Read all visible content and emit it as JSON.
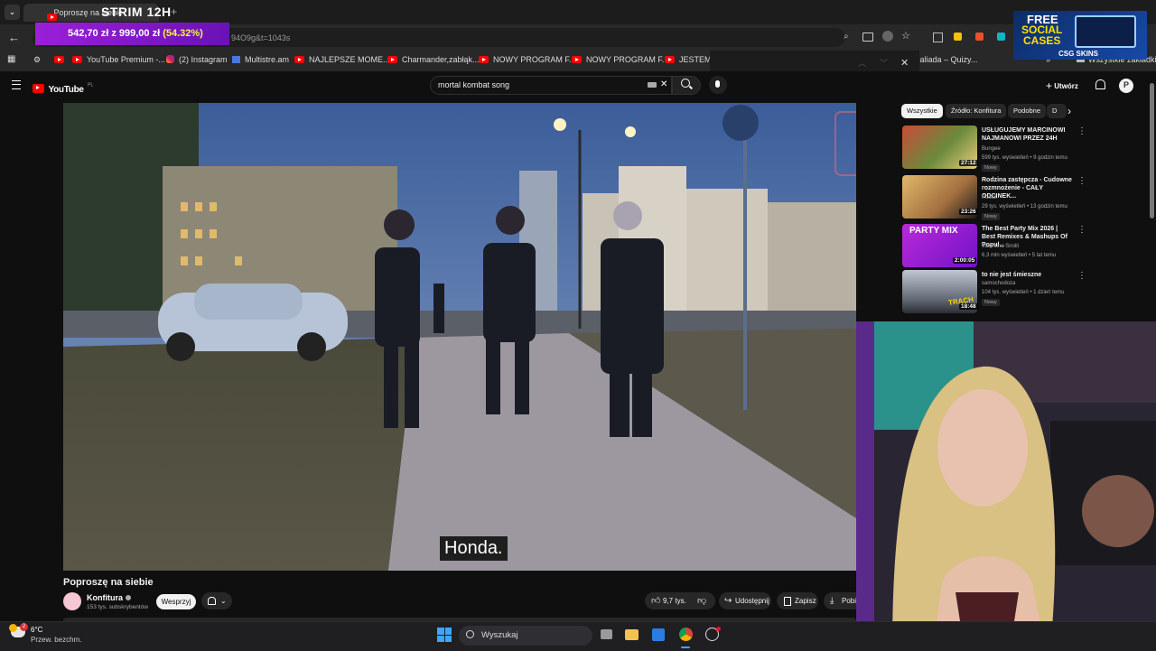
{
  "browser": {
    "tab_title": "Poproszę na siebie",
    "url_fragment": "94O9g&t=1043s",
    "bookmarks": [
      "YouTube Premium -...",
      "(2) Instagram",
      "Multistre.am",
      "NAJLEPSZE MOME...",
      "Charmander,zabłąk...",
      "NOWY PROGRAM F...",
      "NOWY PROGRAM F...",
      "JESTEM D",
      "sialiada – Quizy...",
      "Wszystkie zakładki"
    ]
  },
  "overlays": {
    "stream_label": "STRIM 12H",
    "donation_amount": "542,70 zł z 999,00 zł",
    "donation_percent": "(54.32%)",
    "ad_line1": "FREE",
    "ad_line2": "SOCIAL",
    "ad_line3": "CASES",
    "ad_brand": "CSG SKINS"
  },
  "youtube": {
    "logo": "YouTube",
    "logo_region": "PL",
    "search_query": "mortal kombat song",
    "create_label": "Utwórz",
    "subtitle": "Honda.",
    "video_title": "Poproszę na siebie",
    "channel_name": "Konfitura",
    "subscribers": "153 tys. subskrybentów",
    "support_label": "Wesprzyj",
    "likes": "9,7 tys.",
    "share_label": "Udostępnij",
    "save_label": "Zapisz",
    "download_label": "Pobi",
    "chips": [
      "Wszystkie",
      "Źródło: Konfitura",
      "Podobne",
      "D"
    ],
    "recommendations": [
      {
        "title": "USŁUGUJEMY MARCINOWI NAJMANOWI PRZEZ 24H",
        "channel": "Bungee",
        "meta": "599 tys. wyświetleń • 9 godzin temu",
        "badge": "Nowy",
        "duration": "27:12",
        "color": "#6a8a3b"
      },
      {
        "title": "Rodzina zastępcza - Cudowne rozmnożenie - CAŁY ODCINEK...",
        "channel": "Polsat",
        "meta": "29 tys. wyświetleń • 13 godzin temu",
        "badge": "Nowy",
        "duration": "23:26",
        "color": "#c7a25a"
      },
      {
        "title": "The Best Party Mix 2026 | Best Remixes & Mashups Of Popul...",
        "channel": "Valentino Sirolli",
        "meta": "6,3 mln wyświetleń • 5 lat temu",
        "badge": "",
        "duration": "2:00:05",
        "color": "#a21dd1"
      },
      {
        "title": "to nie jest śmieszne",
        "channel": "samochodoza",
        "meta": "104 tys. wyświetleń • 1 dzień temu",
        "badge": "Nowy",
        "duration": "18:48",
        "color": "#7a8796"
      }
    ],
    "thumb_party_text": "PARTY MIX",
    "thumb_trach_text": "TRACH"
  },
  "taskbar": {
    "temperature": "6°C",
    "weather": "Przew. bezchm.",
    "weather_badge": "2",
    "search_placeholder": "Wyszukaj"
  }
}
